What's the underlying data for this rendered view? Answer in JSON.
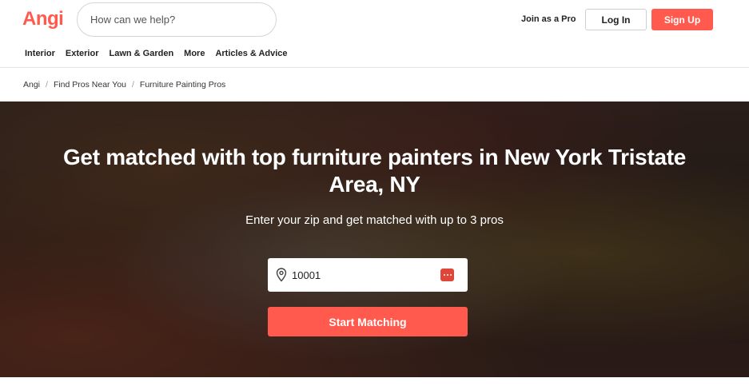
{
  "header": {
    "logo_text": "Angi",
    "search_placeholder": "How can we help?",
    "join_pro_label": "Join as a Pro",
    "login_label": "Log In",
    "signup_label": "Sign Up"
  },
  "nav": {
    "items": [
      "Interior",
      "Exterior",
      "Lawn & Garden",
      "More",
      "Articles & Advice"
    ]
  },
  "breadcrumb": {
    "items": [
      "Angi",
      "Find Pros Near You",
      "Furniture Painting Pros"
    ],
    "separator": "/"
  },
  "hero": {
    "title_line1": "Get matched with top furniture painters in New York Tristate",
    "title_line2": "Area, NY",
    "subtitle": "Enter your zip and get matched with up to 3 pros",
    "zip_value": "10001",
    "cta_label": "Start Matching"
  },
  "colors": {
    "brand": "#ff5a4d",
    "text": "#222222"
  },
  "icons": {
    "zip_field_icon": "map-pin-icon",
    "autofill_icon": "password-manager-icon"
  }
}
